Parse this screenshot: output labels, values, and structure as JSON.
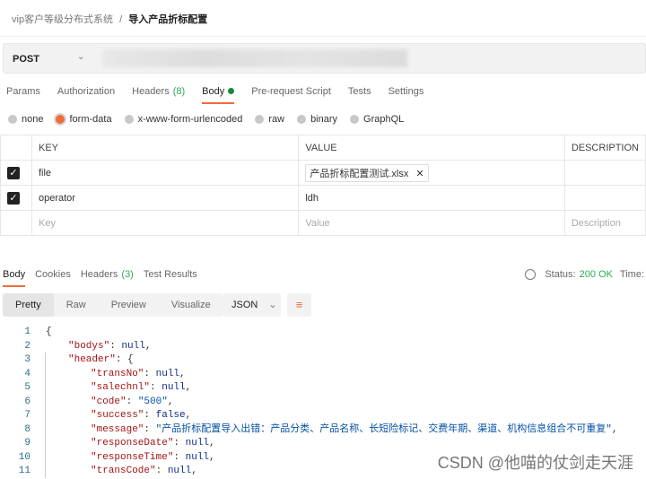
{
  "breadcrumb": {
    "parent": "vip客户等级分布式系统",
    "separator": "/",
    "current": "导入产品折标配置"
  },
  "request": {
    "method": "POST"
  },
  "tabs": [
    {
      "label": "Params"
    },
    {
      "label": "Authorization"
    },
    {
      "label": "Headers",
      "count": "(8)"
    },
    {
      "label": "Body"
    },
    {
      "label": "Pre-request Script"
    },
    {
      "label": "Tests"
    },
    {
      "label": "Settings"
    }
  ],
  "body_types": [
    "none",
    "form-data",
    "x-www-form-urlencoded",
    "raw",
    "binary",
    "GraphQL"
  ],
  "body_type_selected": "form-data",
  "table": {
    "headers": [
      "KEY",
      "VALUE",
      "DESCRIPTION"
    ],
    "rows": [
      {
        "key": "file",
        "value": "产品折标配置测试.xlsx",
        "checked": true
      },
      {
        "key": "operator",
        "value": "ldh",
        "checked": true
      }
    ],
    "placeholder": {
      "key": "Key",
      "value": "Value",
      "description": "Description"
    }
  },
  "response": {
    "tabs": [
      {
        "label": "Body"
      },
      {
        "label": "Cookies"
      },
      {
        "label": "Headers",
        "count": "(3)"
      },
      {
        "label": "Test Results"
      }
    ],
    "status_label": "Status:",
    "status_value": "200 OK",
    "time_label": "Time:",
    "views": [
      "Pretty",
      "Raw",
      "Preview",
      "Visualize"
    ],
    "format": "JSON"
  },
  "code_lines": [
    {
      "n": "1",
      "indent": 0,
      "parts": [
        [
          "p",
          "{"
        ]
      ]
    },
    {
      "n": "2",
      "indent": 1,
      "parts": [
        [
          "k",
          "\"bodys\""
        ],
        [
          "p",
          ": "
        ],
        [
          "n",
          "null"
        ],
        [
          "p",
          ","
        ]
      ]
    },
    {
      "n": "3",
      "indent": 1,
      "parts": [
        [
          "k",
          "\"header\""
        ],
        [
          "p",
          ": {"
        ]
      ]
    },
    {
      "n": "4",
      "indent": 2,
      "parts": [
        [
          "k",
          "\"transNo\""
        ],
        [
          "p",
          ": "
        ],
        [
          "n",
          "null"
        ],
        [
          "p",
          ","
        ]
      ]
    },
    {
      "n": "5",
      "indent": 2,
      "parts": [
        [
          "k",
          "\"salechnl\""
        ],
        [
          "p",
          ": "
        ],
        [
          "n",
          "null"
        ],
        [
          "p",
          ","
        ]
      ]
    },
    {
      "n": "6",
      "indent": 2,
      "parts": [
        [
          "k",
          "\"code\""
        ],
        [
          "p",
          ": "
        ],
        [
          "s",
          "\"500\""
        ],
        [
          "p",
          ","
        ]
      ]
    },
    {
      "n": "7",
      "indent": 2,
      "parts": [
        [
          "k",
          "\"success\""
        ],
        [
          "p",
          ": "
        ],
        [
          "n",
          "false"
        ],
        [
          "p",
          ","
        ]
      ]
    },
    {
      "n": "8",
      "indent": 2,
      "parts": [
        [
          "k",
          "\"message\""
        ],
        [
          "p",
          ": "
        ],
        [
          "s",
          "\"产品折标配置导入出错：产品分类、产品名称、长短险标记、交费年期、渠道、机构信息组合不可重复\""
        ],
        [
          "p",
          ","
        ]
      ]
    },
    {
      "n": "9",
      "indent": 2,
      "parts": [
        [
          "k",
          "\"responseDate\""
        ],
        [
          "p",
          ": "
        ],
        [
          "n",
          "null"
        ],
        [
          "p",
          ","
        ]
      ]
    },
    {
      "n": "10",
      "indent": 2,
      "parts": [
        [
          "k",
          "\"responseTime\""
        ],
        [
          "p",
          ": "
        ],
        [
          "n",
          "null"
        ],
        [
          "p",
          ","
        ]
      ]
    },
    {
      "n": "11",
      "indent": 2,
      "parts": [
        [
          "k",
          "\"transCode\""
        ],
        [
          "p",
          ": "
        ],
        [
          "n",
          "null"
        ],
        [
          "p",
          ","
        ]
      ]
    }
  ],
  "watermark": "CSDN @他喵的仗剑走天涯",
  "colors": {
    "accent": "#f26b3a",
    "success": "#2eaa55"
  }
}
